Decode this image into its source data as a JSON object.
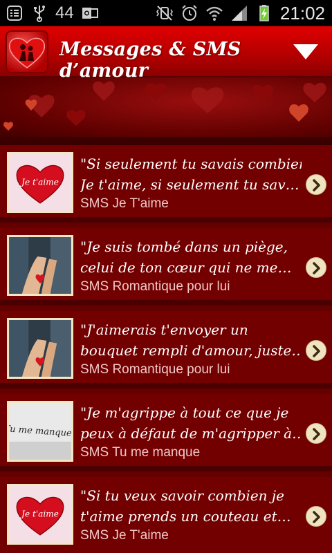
{
  "status_bar": {
    "notification_count": "44",
    "time": "21:02",
    "icons": [
      "notification-list-icon",
      "usb-icon",
      "outlook-icon",
      "vibrate-mute-icon",
      "alarm-icon",
      "wifi-icon",
      "signal-icon",
      "battery-charging-icon"
    ]
  },
  "header": {
    "title": "Messages & SMS d’amour",
    "menu_icon": "dropdown-arrow-icon"
  },
  "messages": [
    {
      "line1": "\"Si seulement tu savais combien",
      "line2": "Je t'aime, si seulement tu sav…",
      "category": "SMS Je T'aime",
      "thumb": "heart-je-taime"
    },
    {
      "line1": "\"Je suis tombé dans un piège,",
      "line2": "celui de ton cœur qui ne me…",
      "category": "SMS Romantique pour lui",
      "thumb": "hands-heart"
    },
    {
      "line1": "\"J'aimerais t'envoyer un",
      "line2": "bouquet rempli d'amour, juste…",
      "category": "SMS Romantique pour lui",
      "thumb": "hands-heart"
    },
    {
      "line1": "\"Je m'agrippe à tout ce que je",
      "line2": "peux à défaut de m'agripper à…",
      "category": "SMS Tu me manque",
      "thumb": "tu-me-manques"
    },
    {
      "line1": "\"Si tu veux savoir combien je",
      "line2": "t'aime prends un couteau et…",
      "category": "SMS Je T'aime",
      "thumb": "heart-je-taime"
    }
  ],
  "thumb_texts": {
    "heart_label": "Je t'aime",
    "handwriting": "Tu me manques"
  }
}
